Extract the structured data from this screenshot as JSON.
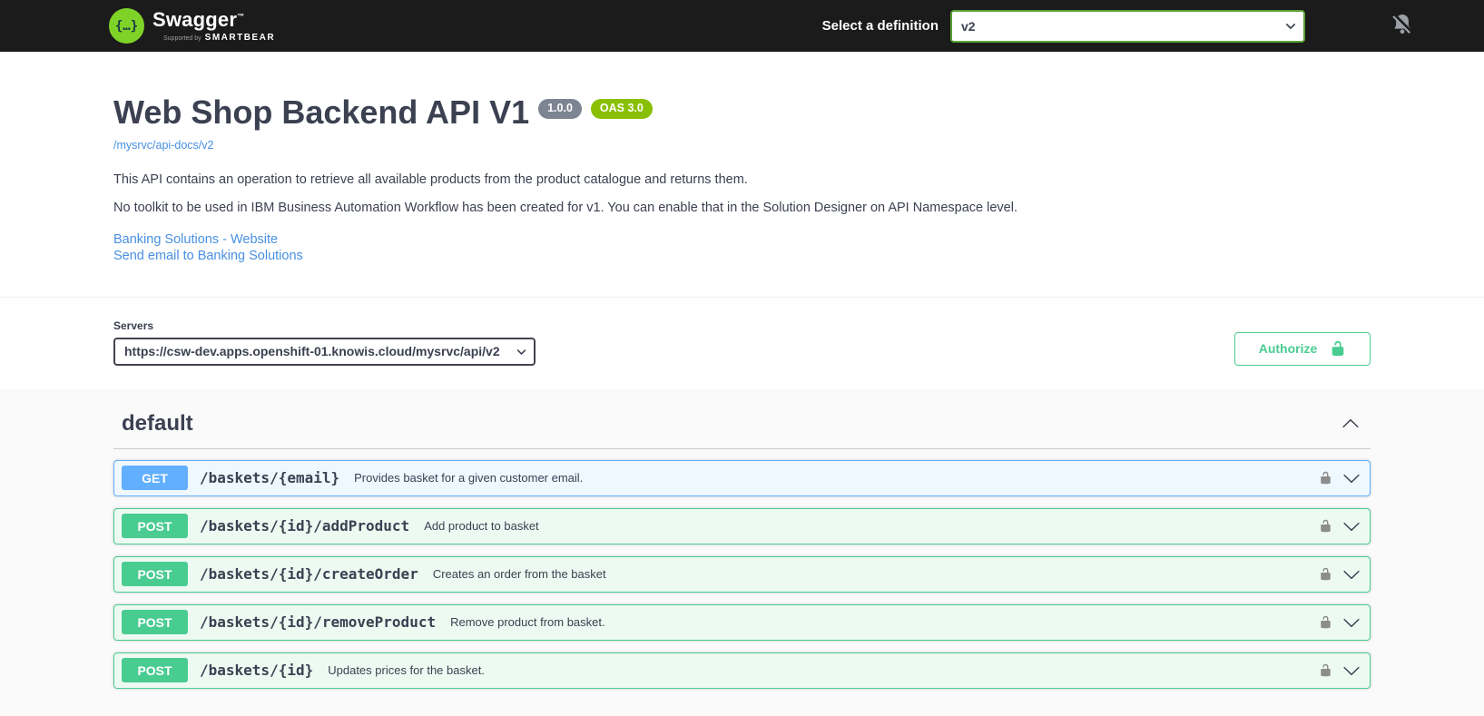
{
  "topbar": {
    "logo": {
      "braces": "{…}",
      "brand": "Swagger",
      "trademark": "™",
      "supported_by": "Supported by",
      "smartbear": "SMARTBEAR"
    },
    "definition": {
      "label": "Select a definition",
      "selected_value": "v2"
    },
    "icons": {
      "bell_muted": "notifications-off-icon",
      "select_arrow": "chevron-down-icon"
    }
  },
  "info": {
    "title": "Web Shop Backend API V1",
    "version_badge": "1.0.0",
    "oas_badge": "OAS 3.0",
    "spec_link": "/mysrvc/api-docs/v2",
    "description_line1": "This API contains an operation to retrieve all available products from the product catalogue and returns them.",
    "description_line2": "No toolkit to be used in IBM Business Automation Workflow has been created for v1. You can enable that in the Solution Designer on API Namespace level.",
    "links": {
      "website": "Banking Solutions - Website",
      "email": "Send email to Banking Solutions"
    }
  },
  "servers": {
    "label": "Servers",
    "selected_url": "https://csw-dev.apps.openshift-01.knowis.cloud/mysrvc/api/v2"
  },
  "auth": {
    "authorize_label": "Authorize",
    "icon": "unlocked-padlock-icon"
  },
  "section": {
    "title": "default",
    "collapse_icon": "chevron-up-icon"
  },
  "operations": [
    {
      "method": "GET",
      "path": "/baskets/{email}",
      "description": "Provides basket for a given customer email."
    },
    {
      "method": "POST",
      "path": "/baskets/{id}/addProduct",
      "description": "Add product to basket"
    },
    {
      "method": "POST",
      "path": "/baskets/{id}/createOrder",
      "description": "Creates an order from the basket"
    },
    {
      "method": "POST",
      "path": "/baskets/{id}/removeProduct",
      "description": "Remove product from basket."
    },
    {
      "method": "POST",
      "path": "/baskets/{id}",
      "description": "Updates prices for the basket."
    }
  ],
  "colors": {
    "topbar_bg": "#1b1b1b",
    "logo_green": "#7fd327",
    "definition_select_border": "#5ba135",
    "get_accent": "#61affe",
    "post_accent": "#49cc90",
    "authorize_green": "#49cc90",
    "link_blue": "#4990e2",
    "version_badge_bg": "#7d8492",
    "oas_badge_bg": "#89bf04",
    "text_main": "#3b4151",
    "ops_bg": "#fafafa"
  }
}
